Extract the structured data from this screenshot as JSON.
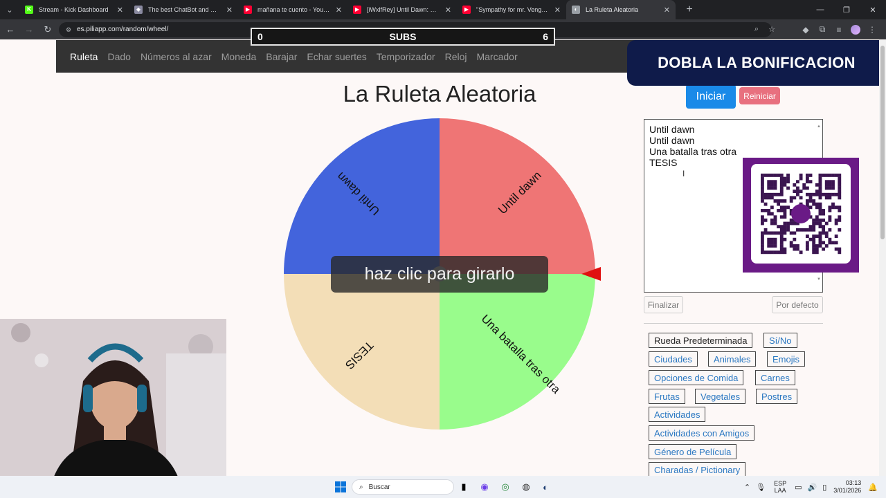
{
  "browser": {
    "tabs": [
      {
        "title": "Stream - Kick Dashboard",
        "favicon": "kick-icon",
        "color": "#53fc18",
        "glyph": "K",
        "active": false
      },
      {
        "title": "The best ChatBot and Widgets",
        "favicon": "streamelements-icon",
        "color": "#8a8aa0",
        "glyph": "◆",
        "active": false
      },
      {
        "title": "mañana te cuento - YouTube",
        "favicon": "youtube-icon",
        "color": "#ff0033",
        "glyph": "▶",
        "active": false
      },
      {
        "title": "[iWxlfRey] Until Dawn: Noche d",
        "favicon": "youtube-icon",
        "color": "#ff0033",
        "glyph": "▶",
        "active": false
      },
      {
        "title": "\"Sympathy for mr. Vengeance\"",
        "favicon": "youtube-icon",
        "color": "#ff0033",
        "glyph": "▶",
        "active": false
      },
      {
        "title": "La Ruleta Aleatoria",
        "favicon": "piliapp-icon",
        "color": "#9aa0a6",
        "glyph": "◐",
        "active": true
      }
    ],
    "url": "es.piliapp.com/random/wheel/"
  },
  "stream_overlay": {
    "subs_left": "0",
    "subs_label": "SUBS",
    "subs_right": "6",
    "banner": "DOBLA LA BONIFICACION"
  },
  "site_nav": [
    {
      "label": "Ruleta",
      "active": true
    },
    {
      "label": "Dado",
      "active": false
    },
    {
      "label": "Números al azar",
      "active": false
    },
    {
      "label": "Moneda",
      "active": false
    },
    {
      "label": "Barajar",
      "active": false
    },
    {
      "label": "Echar suertes",
      "active": false
    },
    {
      "label": "Temporizador",
      "active": false
    },
    {
      "label": "Reloj",
      "active": false
    },
    {
      "label": "Marcador",
      "active": false
    }
  ],
  "title": "La Ruleta Aleatoria",
  "wheel": {
    "segments": [
      {
        "label": "Until dawn",
        "color": "#ef7575"
      },
      {
        "label": "Una batalla tras otra",
        "color": "#99fc8c"
      },
      {
        "label": "TESIS",
        "color": "#f3deb7"
      },
      {
        "label": "Until dawn",
        "color": "#4364dc"
      }
    ],
    "pointer_color": "#e01010",
    "overlay_text": "haz clic para girarlo"
  },
  "controls": {
    "start": "Iniciar",
    "reset": "Reiniciar",
    "entries": [
      "Until dawn",
      "Until dawn",
      "Una batalla tras otra",
      "TESIS"
    ],
    "finish": "Finalizar",
    "default": "Por defecto"
  },
  "presets": [
    {
      "label": "Rueda Predeterminada",
      "selected": true
    },
    {
      "label": "Sí/No",
      "selected": false
    },
    {
      "label": "Ciudades",
      "selected": false
    },
    {
      "label": "Animales",
      "selected": false
    },
    {
      "label": "Emojis",
      "selected": false
    },
    {
      "label": "Opciones de Comida",
      "selected": false
    },
    {
      "label": "Carnes",
      "selected": false
    },
    {
      "label": "Frutas",
      "selected": false
    },
    {
      "label": "Vegetales",
      "selected": false
    },
    {
      "label": "Postres",
      "selected": false
    },
    {
      "label": "Actividades",
      "selected": false
    },
    {
      "label": "Actividades con Amigos",
      "selected": false
    },
    {
      "label": "Género de Película",
      "selected": false
    },
    {
      "label": "Charadas / Pictionary",
      "selected": false
    }
  ],
  "taskbar": {
    "search_placeholder": "Buscar",
    "lang_line1": "ESP",
    "lang_line2": "LAA",
    "time": "03:13",
    "date": "3/01/2026"
  }
}
